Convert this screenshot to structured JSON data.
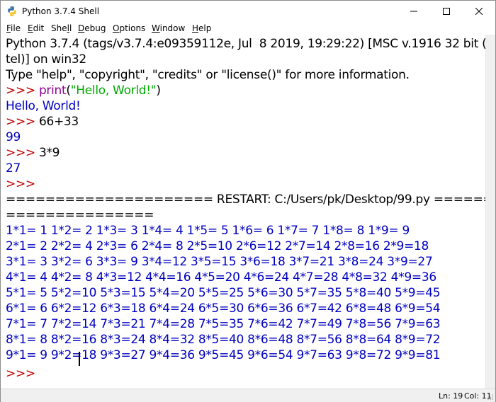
{
  "window": {
    "title": "Python 3.7.4 Shell",
    "controls": [
      "minimize",
      "maximize",
      "close"
    ]
  },
  "menu": [
    {
      "accel": "F",
      "rest": "ile"
    },
    {
      "accel": "E",
      "rest": "dit"
    },
    {
      "pre": "She",
      "accel": "l",
      "rest": "l"
    },
    {
      "accel": "D",
      "rest": "ebug"
    },
    {
      "accel": "O",
      "rest": "ptions"
    },
    {
      "accel": "W",
      "rest": "indow"
    },
    {
      "accel": "H",
      "rest": "elp"
    }
  ],
  "shell": {
    "banner1": "Python 3.7.4 (tags/v3.7.4:e09359112e, Jul  8 2019, 19:29:22) [MSC v.1916 32 bit (In",
    "banner2": "tel)] on win32",
    "banner3": "Type \"help\", \"copyright\", \"credits\" or \"license()\" for more information.",
    "prompt": ">>> ",
    "cmd1_builtin": "print",
    "cmd1_open": "(",
    "cmd1_string": "\"Hello, World!\"",
    "cmd1_close": ")",
    "out1": "Hello, World!",
    "cmd2": "66+33",
    "out2": "99",
    "cmd3": "3*9",
    "out3": "27",
    "restart1": "===================== RESTART: C:/Users/pk/Desktop/99.py ======",
    "restart2": "===============",
    "table": [
      "1*1= 1 1*2= 2 1*3= 3 1*4= 4 1*5= 5 1*6= 6 1*7= 7 1*8= 8 1*9= 9",
      "2*1= 2 2*2= 4 2*3= 6 2*4= 8 2*5=10 2*6=12 2*7=14 2*8=16 2*9=18",
      "3*1= 3 3*2= 6 3*3= 9 3*4=12 3*5=15 3*6=18 3*7=21 3*8=24 3*9=27",
      "4*1= 4 4*2= 8 4*3=12 4*4=16 4*5=20 4*6=24 4*7=28 4*8=32 4*9=36",
      "5*1= 5 5*2=10 5*3=15 5*4=20 5*5=25 5*6=30 5*7=35 5*8=40 5*9=45",
      "6*1= 6 6*2=12 6*3=18 6*4=24 6*5=30 6*6=36 6*7=42 6*8=48 6*9=54",
      "7*1= 7 7*2=14 7*3=21 7*4=28 7*5=35 7*6=42 7*7=49 7*8=56 7*9=63",
      "8*1= 8 8*2=16 8*3=24 8*4=32 8*5=40 8*6=48 8*7=56 8*8=64 8*9=72",
      "9*1= 9 9*2=18 9*3=27 9*4=36 9*5=45 9*6=54 9*7=63 9*8=72 9*9=81"
    ],
    "final_prompt": ">>>"
  },
  "status": {
    "line": "Ln: 19",
    "col": "Col: 11"
  },
  "colors": {
    "prompt": "#c00000",
    "stdout": "#0000c0",
    "builtin": "#900090",
    "string": "#00aa00"
  }
}
